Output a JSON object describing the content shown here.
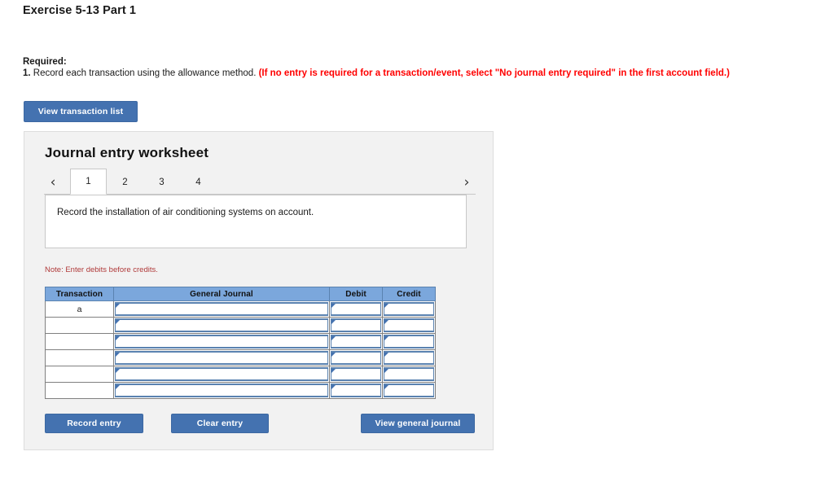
{
  "page": {
    "title": "Exercise 5-13 Part 1"
  },
  "required": {
    "label": "Required:",
    "number": "1.",
    "instruction": " Record each transaction using the allowance method. ",
    "hint": "(If no entry is required for a transaction/event, select \"No journal entry required\" in the first account field.)"
  },
  "toolbar": {
    "view_transaction_list_label": "View transaction list"
  },
  "worksheet": {
    "heading": "Journal entry worksheet",
    "prev_arrow": "‹",
    "next_arrow": "›",
    "tabs": [
      {
        "label": "1",
        "active": true
      },
      {
        "label": "2",
        "active": false
      },
      {
        "label": "3",
        "active": false
      },
      {
        "label": "4",
        "active": false
      }
    ],
    "description": "Record the installation of air conditioning systems on account.",
    "note": "Note: Enter debits before credits."
  },
  "table": {
    "columns": [
      "Transaction",
      "General Journal",
      "Debit",
      "Credit"
    ],
    "rows": [
      {
        "transaction": "a",
        "general_journal": "",
        "debit": "",
        "credit": ""
      },
      {
        "transaction": "",
        "general_journal": "",
        "debit": "",
        "credit": ""
      },
      {
        "transaction": "",
        "general_journal": "",
        "debit": "",
        "credit": ""
      },
      {
        "transaction": "",
        "general_journal": "",
        "debit": "",
        "credit": ""
      },
      {
        "transaction": "",
        "general_journal": "",
        "debit": "",
        "credit": ""
      },
      {
        "transaction": "",
        "general_journal": "",
        "debit": "",
        "credit": ""
      }
    ]
  },
  "footer": {
    "record_entry_label": "Record entry",
    "clear_entry_label": "Clear entry",
    "view_general_journal_label": "View general journal"
  },
  "colors": {
    "button_blue": "#4472b0",
    "table_header_blue": "#7ba7dc",
    "panel_gray": "#f2f2f2",
    "hint_red": "#ff0000",
    "note_red": "#b03a3a"
  }
}
